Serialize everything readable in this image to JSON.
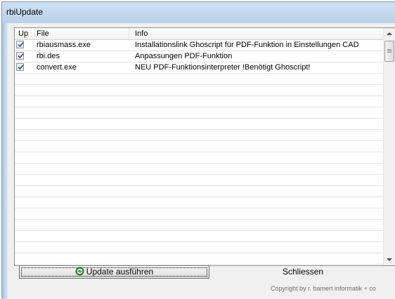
{
  "window": {
    "title": "rbiUpdate"
  },
  "list": {
    "columns": [
      "Up",
      "File",
      "Info"
    ],
    "rows": [
      {
        "checked": true,
        "file": "rbiausmass.exe",
        "info": "Installationslink Ghoscript für PDF-Funktion in Einstellungen CAD"
      },
      {
        "checked": true,
        "file": "rbi.des",
        "info": "Anpassungen PDF-Funktion"
      },
      {
        "checked": true,
        "file": "convert.exe",
        "info": "NEU PDF-Funktionsinterpreter !Benötigt Ghoscript!"
      }
    ]
  },
  "buttons": {
    "update_label": "Update ausführen",
    "close_label": "Schliessen"
  },
  "footer": {
    "copyright": "Copyright by r. bamert informatik + co"
  },
  "icons": {
    "update": "update-icon",
    "checkmark": "checkmark-icon"
  }
}
